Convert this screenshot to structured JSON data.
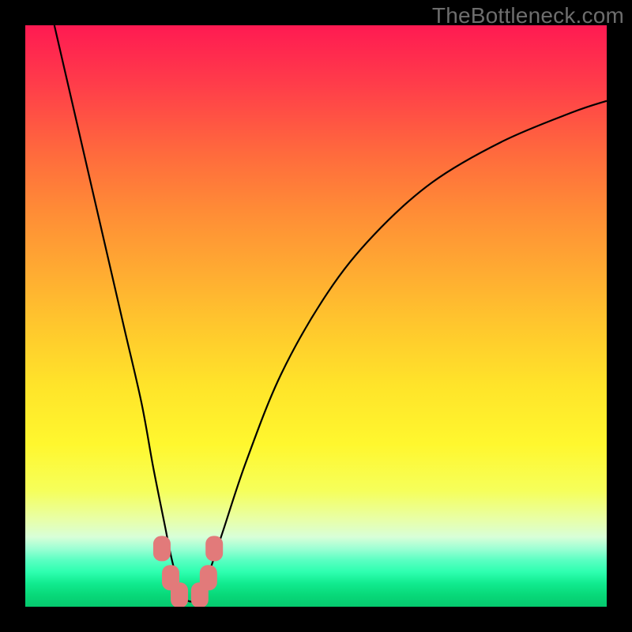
{
  "watermark": "TheBottleneck.com",
  "chart_data": {
    "type": "line",
    "title": "",
    "xlabel": "",
    "ylabel": "",
    "xlim": [
      0,
      100
    ],
    "ylim": [
      0,
      100
    ],
    "grid": false,
    "series": [
      {
        "name": "bottleneck-curve",
        "color": "#000000",
        "x": [
          5,
          8,
          11,
          14,
          17,
          20,
          22,
          24,
          25,
          26,
          27,
          28,
          29,
          30,
          31,
          32,
          34,
          38,
          44,
          52,
          60,
          70,
          82,
          94,
          100
        ],
        "y": [
          100,
          87,
          74,
          61,
          48,
          35,
          24,
          14,
          9,
          5,
          2,
          1,
          1,
          2,
          4,
          7,
          13,
          25,
          40,
          54,
          64,
          73,
          80,
          85,
          87
        ]
      }
    ],
    "markers": [
      {
        "name": "marker-left-upper",
        "x": 23.5,
        "y": 10,
        "color": "#e27a7a"
      },
      {
        "name": "marker-left-lower",
        "x": 25.0,
        "y": 5,
        "color": "#e27a7a"
      },
      {
        "name": "marker-bottom-left",
        "x": 26.5,
        "y": 2,
        "color": "#e27a7a"
      },
      {
        "name": "marker-bottom-right",
        "x": 30.0,
        "y": 2,
        "color": "#e27a7a"
      },
      {
        "name": "marker-right-lower",
        "x": 31.5,
        "y": 5,
        "color": "#e27a7a"
      },
      {
        "name": "marker-right-upper",
        "x": 32.5,
        "y": 10,
        "color": "#e27a7a"
      }
    ],
    "background": {
      "type": "vertical-gradient",
      "stops": [
        {
          "pos": 0,
          "color": "#ff1a52"
        },
        {
          "pos": 72,
          "color": "#fff72e"
        },
        {
          "pos": 90,
          "color": "#9dffd4"
        },
        {
          "pos": 100,
          "color": "#05c96e"
        }
      ]
    }
  }
}
